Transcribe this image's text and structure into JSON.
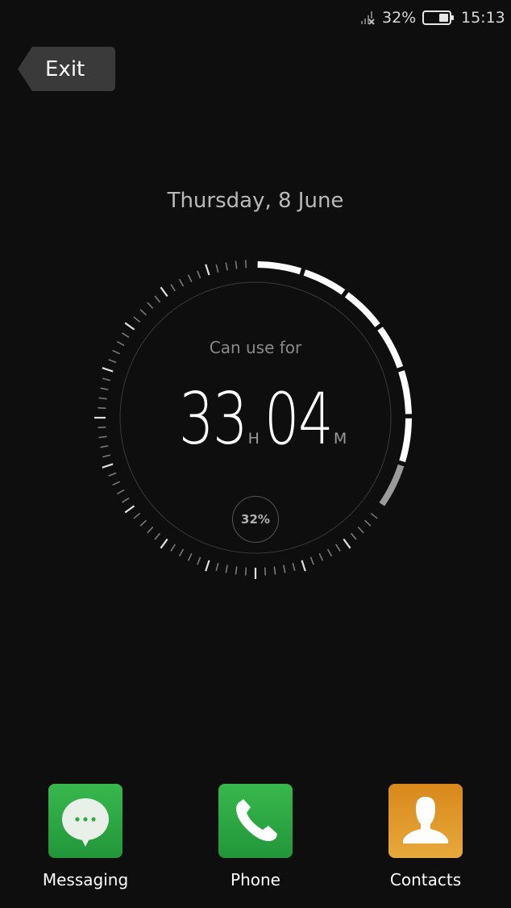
{
  "status_bar": {
    "signal_icon": "signal-no-service-icon",
    "battery_percent": "32%",
    "battery_icon": "battery-icon",
    "battery_level": 0.32,
    "time": "15:13"
  },
  "exit_button": {
    "label": "Exit"
  },
  "date": "Thursday, 8 June",
  "battery_dial": {
    "label": "Can use for",
    "hours": "33",
    "hours_unit": "H",
    "minutes": "04",
    "minutes_unit": "M",
    "percent_label": "32%",
    "level": 0.32
  },
  "dock": {
    "apps": [
      {
        "label": "Messaging",
        "icon": "message-bubble-icon",
        "color": "#2faa43"
      },
      {
        "label": "Phone",
        "icon": "phone-handset-icon",
        "color": "#2faa43"
      },
      {
        "label": "Contacts",
        "icon": "person-silhouette-icon",
        "color": "#e2941f"
      }
    ]
  },
  "colors": {
    "background": "#0e0e0e",
    "accent": "#ffffff",
    "muted": "#8a8a8a"
  }
}
